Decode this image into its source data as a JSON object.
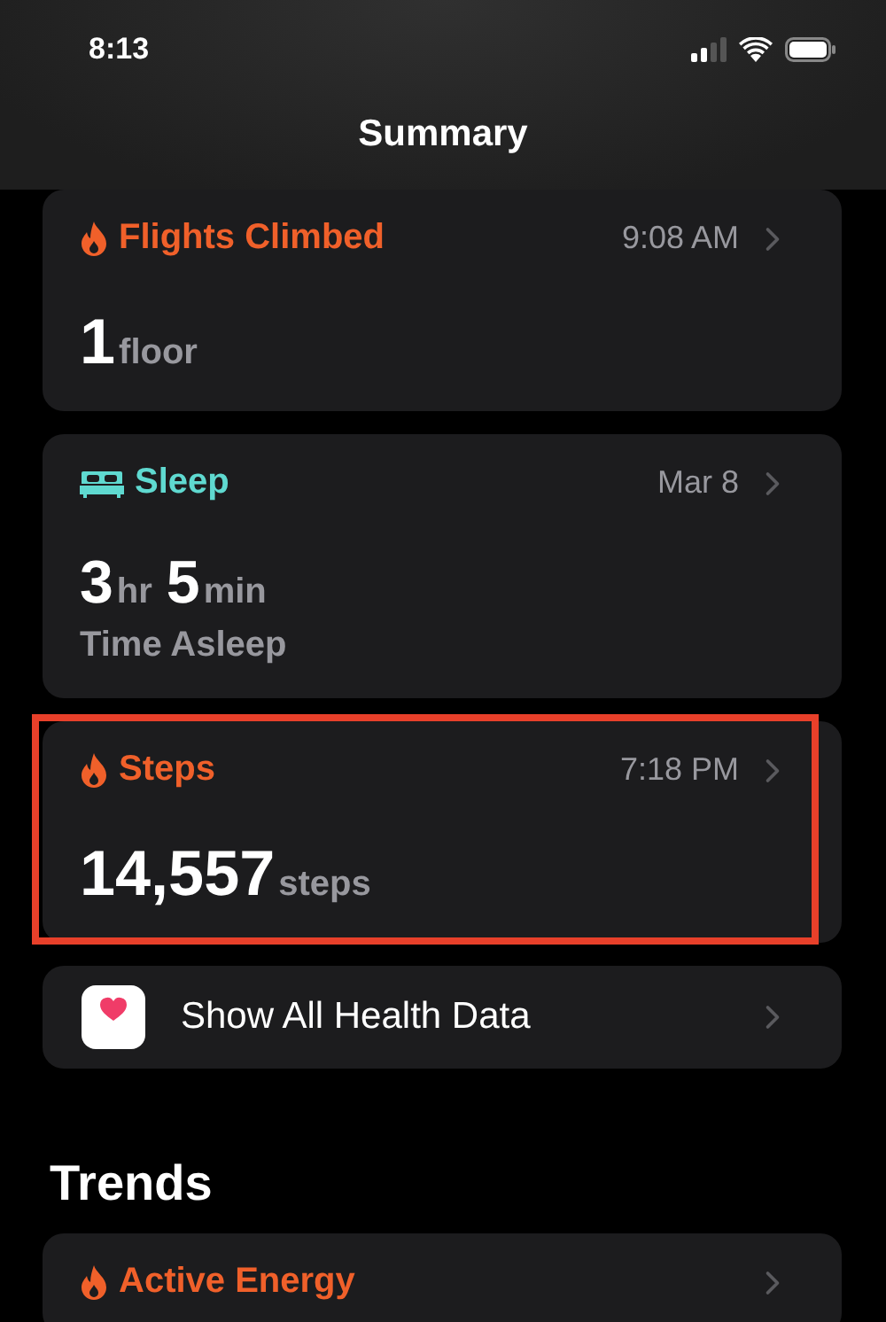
{
  "status_bar": {
    "time": "8:13"
  },
  "nav": {
    "title": "Summary"
  },
  "cards": [
    {
      "kind": "flame",
      "title": "Flights Climbed",
      "color": "#f0602a",
      "time": "9:08 AM",
      "highlighted": false,
      "value": [
        {
          "number": "1",
          "unit": "floor"
        }
      ]
    },
    {
      "kind": "bed",
      "title": "Sleep",
      "color": "#5fd9d0",
      "time": "Mar 8",
      "highlighted": false,
      "value": [
        {
          "number": "3",
          "unit": "hr"
        },
        {
          "number": "5",
          "unit": "min"
        }
      ],
      "subtitle": "Time Asleep"
    },
    {
      "kind": "flame",
      "title": "Steps",
      "color": "#f0602a",
      "time": "7:18 PM",
      "highlighted": true,
      "value": [
        {
          "number": "14,557",
          "unit": "steps"
        }
      ]
    }
  ],
  "show_all": {
    "label": "Show All Health Data"
  },
  "trends": {
    "heading": "Trends",
    "cards": [
      {
        "kind": "flame",
        "title": "Active Energy",
        "color": "#f0602a"
      }
    ]
  }
}
